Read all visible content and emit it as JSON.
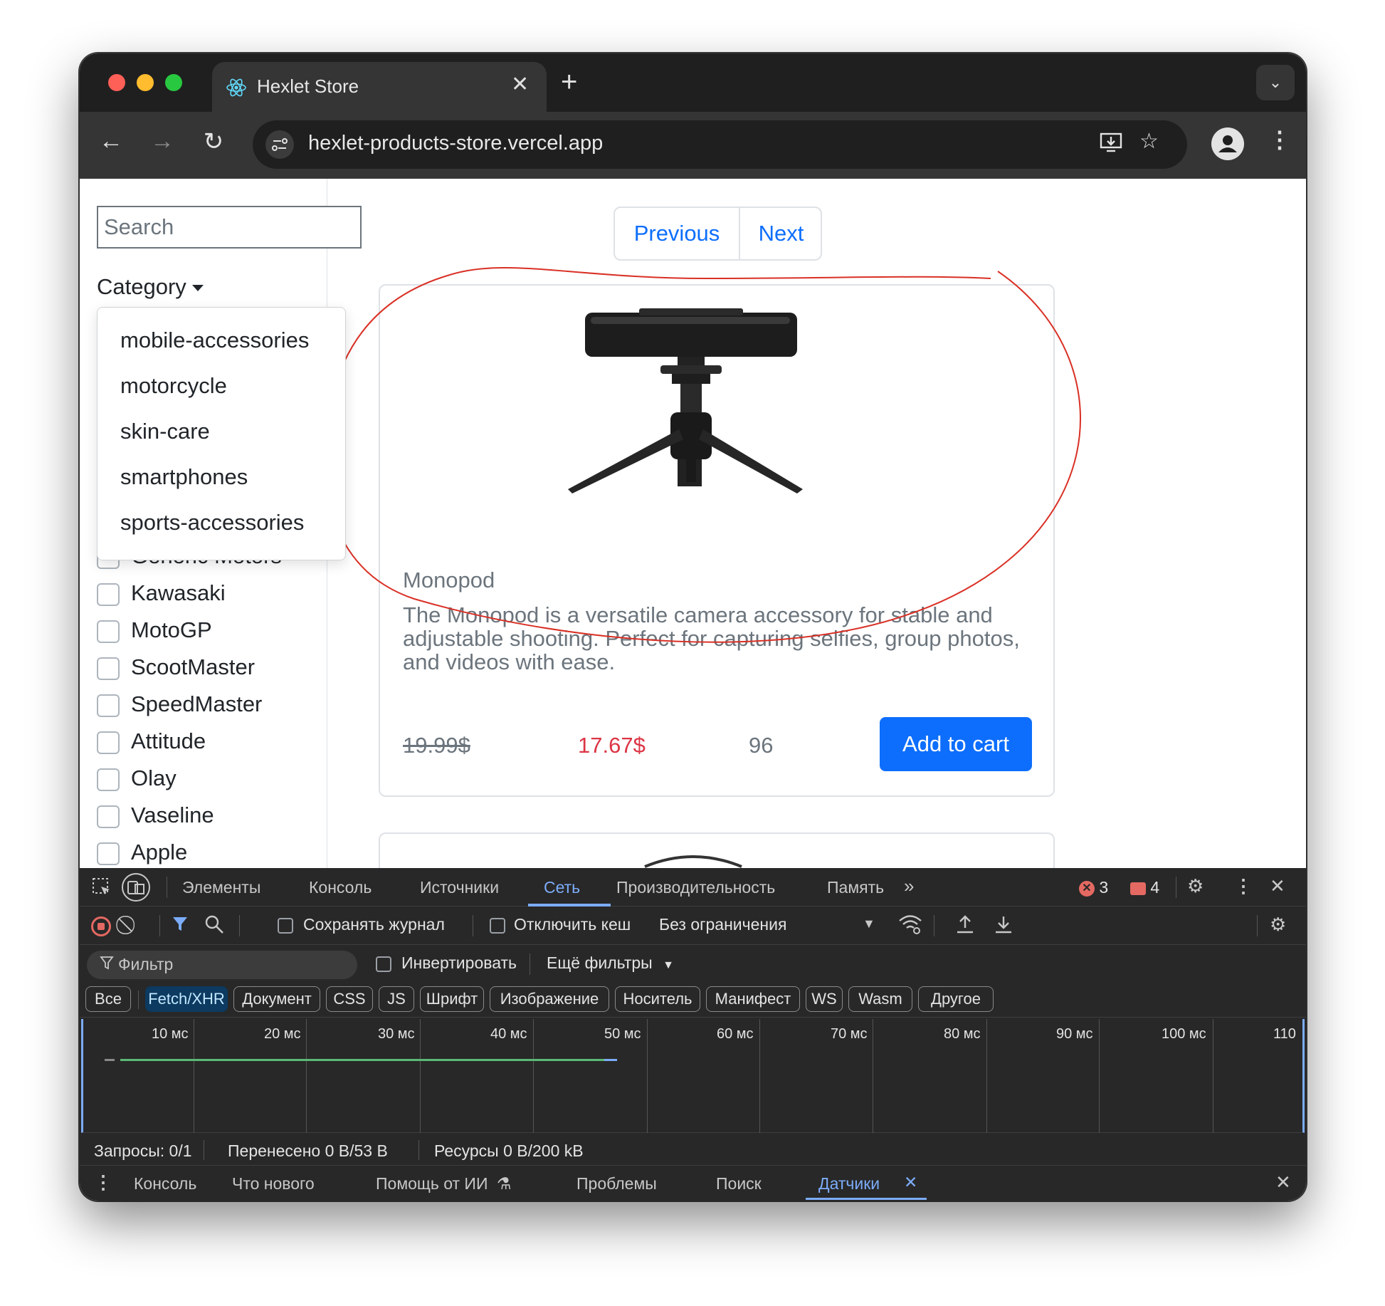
{
  "browser": {
    "tab_title": "Hexlet Store",
    "url": "hexlet-products-store.vercel.app"
  },
  "sidebar": {
    "search_placeholder": "Search",
    "category_label": "Category",
    "category_options": [
      "mobile-accessories",
      "motorcycle",
      "skin-care",
      "smartphones",
      "sports-accessories"
    ],
    "brands": [
      "Generic Motors",
      "Kawasaki",
      "MotoGP",
      "ScootMaster",
      "SpeedMaster",
      "Attitude",
      "Olay",
      "Vaseline",
      "Apple"
    ]
  },
  "pagination": {
    "previous": "Previous",
    "next": "Next"
  },
  "product": {
    "title": "Monopod",
    "description": "The Monopod is a versatile camera accessory for stable and adjustable shooting. Perfect for capturing selfies, group photos, and videos with ease.",
    "old_price": "19.99$",
    "price": "17.67$",
    "stock": "96",
    "add_to_cart": "Add to cart"
  },
  "devtools": {
    "tabs": [
      "Элементы",
      "Консоль",
      "Источники",
      "Сеть",
      "Производительность",
      "Память"
    ],
    "active_tab": "Сеть",
    "errors_count": "3",
    "issues_count": "4",
    "preserve_log": "Сохранять журнал",
    "disable_cache": "Отключить кеш",
    "throttling": "Без ограничения",
    "filter_placeholder": "Фильтр",
    "invert": "Инвертировать",
    "more_filters": "Ещё фильтры",
    "type_filters": [
      "Все",
      "Fetch/XHR",
      "Документ",
      "CSS",
      "JS",
      "Шрифт",
      "Изображение",
      "Носитель",
      "Манифест",
      "WS",
      "Wasm",
      "Другое"
    ],
    "active_type_filter": "Fetch/XHR",
    "timeline_ticks": [
      "10 мс",
      "20 мс",
      "30 мс",
      "40 мс",
      "50 мс",
      "60 мс",
      "70 мс",
      "80 мс",
      "90 мс",
      "100 мс",
      "110"
    ],
    "status": {
      "requests": "Запросы: 0/1",
      "transferred": "Перенесено 0 B/53 B",
      "resources": "Ресурсы 0 B/200 kB"
    },
    "drawer_tabs": [
      "Консоль",
      "Что нового",
      "Помощь от ИИ",
      "Проблемы",
      "Поиск",
      "Датчики"
    ],
    "active_drawer_tab": "Датчики"
  },
  "colors": {
    "accent": "#0d6efd",
    "sale_price": "#dc3545",
    "devtools_accent": "#7cacf8",
    "annotation": "#d93025"
  }
}
